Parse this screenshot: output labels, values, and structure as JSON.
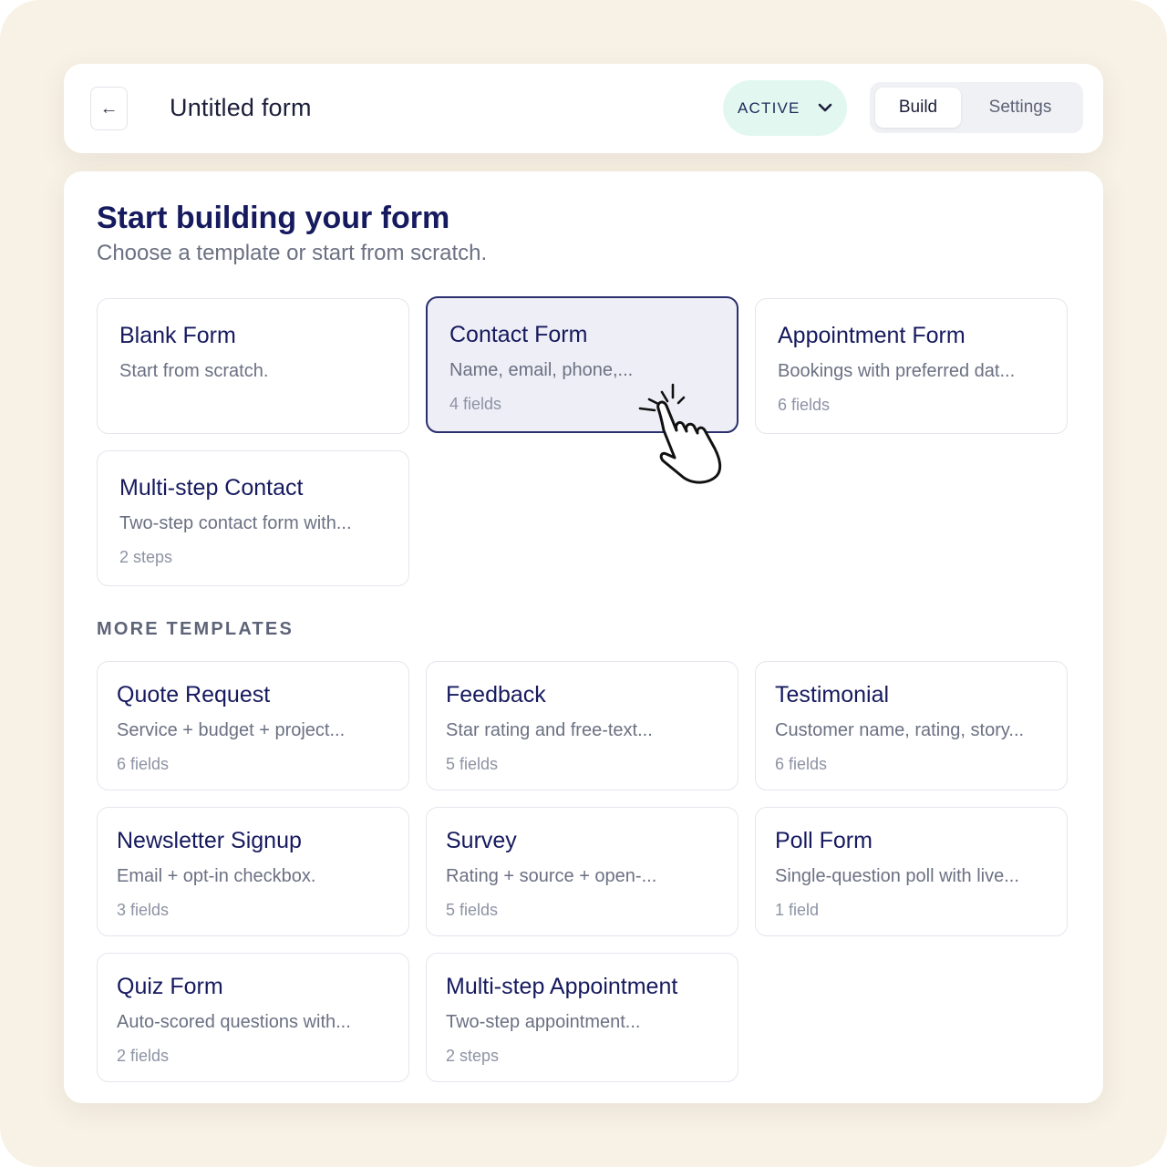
{
  "header": {
    "back_icon": "←",
    "title": "Untitled form",
    "status": {
      "label": "ACTIVE",
      "color": "#e2f7ef"
    },
    "tabs": [
      {
        "label": "Build",
        "active": true
      },
      {
        "label": "Settings",
        "active": false
      }
    ]
  },
  "main": {
    "title": "Start building your form",
    "subtitle": "Choose a template or start from scratch.",
    "featured": [
      {
        "title": "Blank Form",
        "desc": "Start from scratch.",
        "meta": ""
      },
      {
        "title": "Contact Form",
        "desc": "Name, email, phone,...",
        "meta": "4 fields",
        "selected": true
      },
      {
        "title": "Appointment Form",
        "desc": "Bookings with preferred dat...",
        "meta": "6 fields"
      },
      {
        "title": "Multi-step Contact",
        "desc": "Two-step contact form with...",
        "meta": "2 steps"
      }
    ],
    "more_label": "MORE TEMPLATES",
    "more": [
      {
        "title": "Quote Request",
        "desc": "Service + budget + project...",
        "meta": "6 fields"
      },
      {
        "title": "Feedback",
        "desc": "Star rating and free-text...",
        "meta": "5 fields"
      },
      {
        "title": "Testimonial",
        "desc": "Customer name, rating, story...",
        "meta": "6 fields"
      },
      {
        "title": "Newsletter Signup",
        "desc": "Email + opt-in checkbox.",
        "meta": "3 fields"
      },
      {
        "title": "Survey",
        "desc": "Rating + source + open-...",
        "meta": "5 fields"
      },
      {
        "title": "Poll Form",
        "desc": "Single-question poll with live...",
        "meta": "1 field"
      },
      {
        "title": "Quiz Form",
        "desc": "Auto-scored questions with...",
        "meta": "2 fields"
      },
      {
        "title": "Multi-step Appointment",
        "desc": "Two-step appointment...",
        "meta": "2 steps"
      }
    ]
  },
  "cursor_icon": "pointer-hand-click-icon"
}
